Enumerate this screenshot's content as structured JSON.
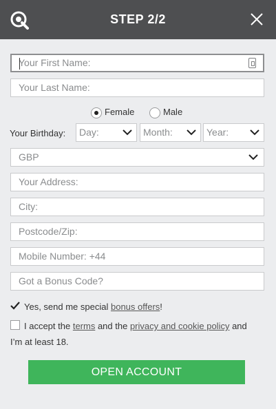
{
  "header": {
    "title": "STEP 2/2"
  },
  "fields": {
    "first_name": "Your First Name:",
    "last_name": "Your Last Name:",
    "address": "Your Address:",
    "city": "City:",
    "postcode": "Postcode/Zip:",
    "mobile": "Mobile Number: +44",
    "bonus": "Got a Bonus Code?"
  },
  "gender": {
    "female": "Female",
    "male": "Male",
    "selected": "Female"
  },
  "birthday": {
    "label": "Your Birthday:",
    "day": "Day:",
    "month": "Month:",
    "year": "Year:"
  },
  "currency": {
    "value": "GBP"
  },
  "offers": {
    "text": "Yes, send me special ",
    "link": "bonus offers",
    "suffix": "!",
    "checked": true
  },
  "terms": {
    "t1": "I accept the ",
    "link1": "terms",
    "t2": " and the ",
    "link2": "privacy and cookie policy",
    "t3": " and",
    "line2": "I’m at least 18.",
    "checked": false
  },
  "button": {
    "label": "OPEN ACCOUNT"
  },
  "colors": {
    "header": "#4e4f51",
    "button": "#3fb55b",
    "background": "#ecedef"
  }
}
